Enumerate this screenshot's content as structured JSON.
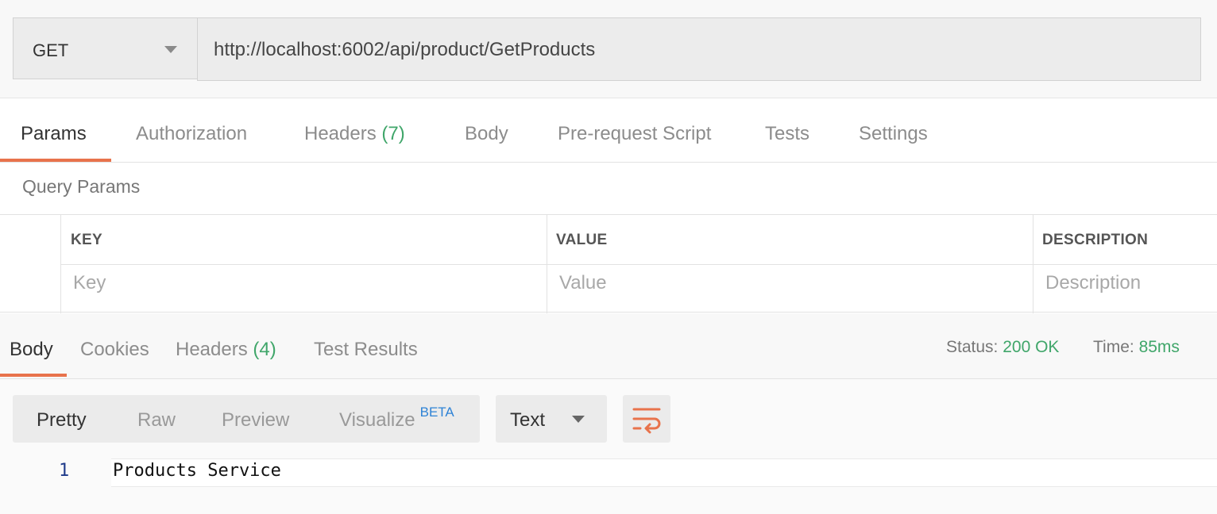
{
  "request": {
    "method": "GET",
    "url": "http://localhost:6002/api/product/GetProducts"
  },
  "request_tabs": [
    {
      "label": "Params",
      "active": true
    },
    {
      "label": "Authorization"
    },
    {
      "label": "Headers",
      "count": "(7)"
    },
    {
      "label": "Body"
    },
    {
      "label": "Pre-request Script"
    },
    {
      "label": "Tests"
    },
    {
      "label": "Settings"
    }
  ],
  "query_params": {
    "title": "Query Params",
    "columns": [
      "KEY",
      "VALUE",
      "DESCRIPTION"
    ],
    "placeholders": {
      "key": "Key",
      "value": "Value",
      "description": "Description"
    }
  },
  "response": {
    "tabs": [
      {
        "label": "Body",
        "active": true
      },
      {
        "label": "Cookies"
      },
      {
        "label": "Headers",
        "count": "(4)"
      },
      {
        "label": "Test Results"
      }
    ],
    "status_label": "Status:",
    "status_value": "200 OK",
    "time_label": "Time:",
    "time_value": "85ms",
    "view_modes": [
      "Pretty",
      "Raw",
      "Preview",
      "Visualize"
    ],
    "beta_badge": "BETA",
    "format": "Text",
    "body_lines": [
      {
        "line": "1",
        "text": "Products Service"
      }
    ]
  },
  "colors": {
    "accent": "#e8734c",
    "success": "#40a66a",
    "beta": "#2f83d6"
  },
  "icons": [
    "chevron-down-icon",
    "wrap-lines-icon"
  ]
}
